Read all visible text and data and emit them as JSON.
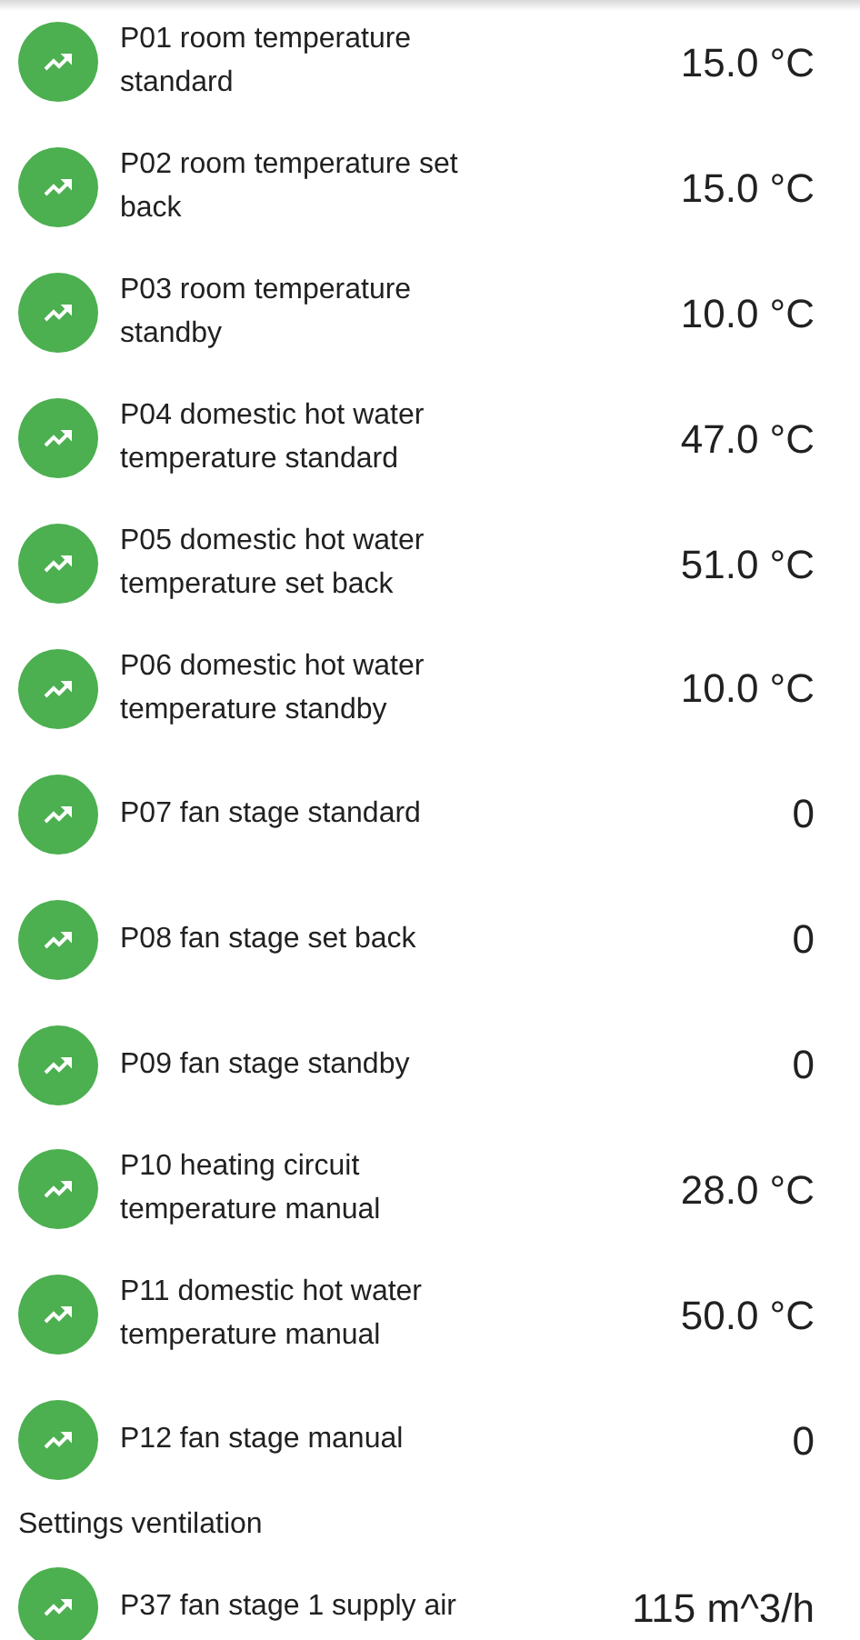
{
  "sections": [
    {
      "items": [
        {
          "label": "P01 room temperature standard",
          "value": "15.0 °C"
        },
        {
          "label": "P02 room temperature set back",
          "value": "15.0 °C"
        },
        {
          "label": "P03 room temperature standby",
          "value": "10.0 °C"
        },
        {
          "label": "P04 domestic hot water temperature standard",
          "value": "47.0 °C"
        },
        {
          "label": "P05 domestic hot water temperature set back",
          "value": "51.0 °C"
        },
        {
          "label": "P06 domestic hot water temperature standby",
          "value": "10.0 °C"
        },
        {
          "label": "P07 fan stage standard",
          "value": "0"
        },
        {
          "label": "P08 fan stage set back",
          "value": "0"
        },
        {
          "label": "P09 fan stage standby",
          "value": "0"
        },
        {
          "label": "P10 heating circuit temperature manual",
          "value": "28.0 °C"
        },
        {
          "label": "P11 domestic hot water temperature manual",
          "value": "50.0 °C"
        },
        {
          "label": "P12 fan stage manual",
          "value": "0"
        }
      ]
    },
    {
      "title": "Settings ventilation",
      "items": [
        {
          "label": "P37 fan stage 1 supply air",
          "value": "115 m^3/h"
        }
      ]
    }
  ]
}
